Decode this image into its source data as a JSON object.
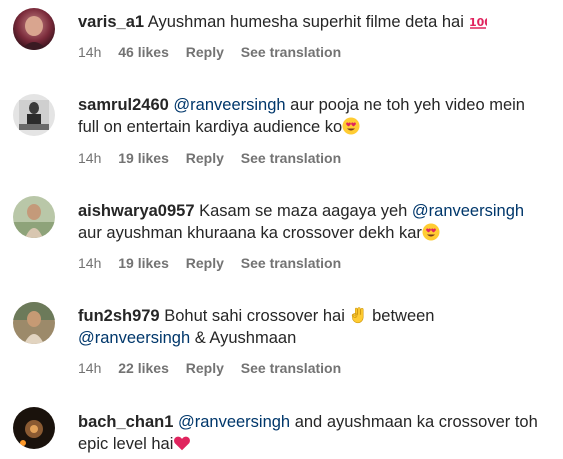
{
  "comments": [
    {
      "username": "varis_a1",
      "text_parts": [
        "Ayushman humesha superhit filme deta hai"
      ],
      "emoji": "hundred-points-emoji",
      "time": "14h",
      "likes": "46 likes",
      "reply": "Reply",
      "translate": "See translation"
    },
    {
      "username": "samrul2460",
      "mention": "@ranveersingh",
      "text_parts": [
        "aur pooja ne toh yeh video mein full on entertain kardiya audience ko"
      ],
      "emoji": "heart-eyes-emoji",
      "time": "14h",
      "likes": "19 likes",
      "reply": "Reply",
      "translate": "See translation"
    },
    {
      "username": "aishwarya0957",
      "text_before": "Kasam se maza aagaya yeh",
      "mention": "@ranveersingh",
      "text_after": "aur ayushman khuraana ka crossover dekh kar",
      "emoji": "heart-eyes-emoji",
      "time": "14h",
      "likes": "19 likes",
      "reply": "Reply",
      "translate": "See translation"
    },
    {
      "username": "fun2sh979",
      "text_before": "Bohut sahi crossover hai",
      "emoji": "ok-hand-emoji",
      "text_mid": "between",
      "mention": "@ranveersingh",
      "text_after": "& Ayushmaan",
      "time": "14h",
      "likes": "22 likes",
      "reply": "Reply",
      "translate": "See translation"
    },
    {
      "username": "bach_chan1",
      "mention": "@ranveersingh",
      "text_after": "and ayushmaan ka crossover toh epic level hai",
      "emoji": "red-heart-emoji",
      "time": "",
      "likes": "",
      "reply": "",
      "translate": ""
    }
  ],
  "colors": {
    "text": "#262626",
    "meta": "#737373",
    "mention": "#00376b",
    "background": "#ffffff"
  }
}
